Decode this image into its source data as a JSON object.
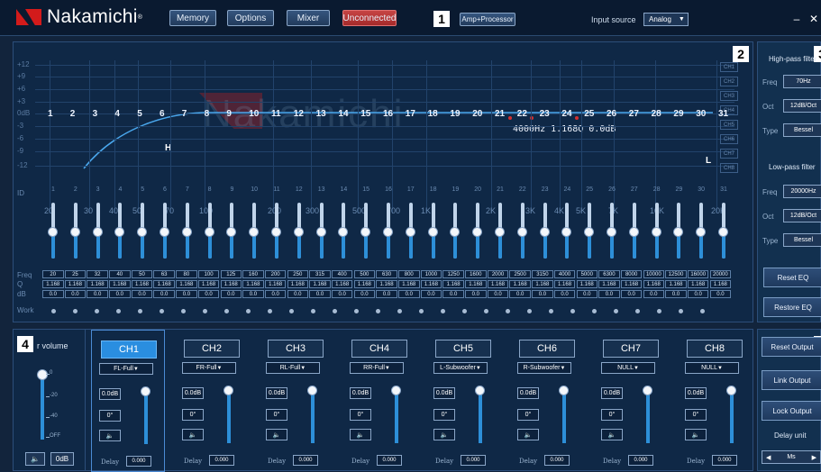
{
  "app": {
    "brand": "Nakamichi",
    "reg": "®"
  },
  "topbar": {
    "memory": "Memory",
    "options": "Options",
    "mixer": "Mixer",
    "connection": "Unconnected",
    "marker1": "1",
    "amp_processor": "Amp+Processor",
    "input_source_label": "Input source",
    "input_source_value": "Analog",
    "minimize": "–",
    "close": "✕"
  },
  "eq": {
    "marker": "2",
    "y_labels": [
      "+12",
      "+9",
      "+6",
      "+3",
      "0dB",
      "-3",
      "-6",
      "-9",
      "-12"
    ],
    "x_labels": [
      "20",
      "30",
      "40",
      "50",
      "70",
      "100",
      "200",
      "300",
      "500",
      "700",
      "1K",
      "2K",
      "3K",
      "4K",
      "5K",
      "7K",
      "10K",
      "20K"
    ],
    "ch_boxes": [
      "CH1",
      "CH2",
      "CH3",
      "CH4",
      "CH5",
      "CH6",
      "CH7",
      "CH8"
    ],
    "band_numbers": [
      "1",
      "2",
      "3",
      "4",
      "5",
      "6",
      "7",
      "8",
      "9",
      "10",
      "11",
      "12",
      "13",
      "14",
      "15",
      "16",
      "17",
      "18",
      "19",
      "20",
      "21",
      "22",
      "23",
      "24",
      "25",
      "26",
      "27",
      "28",
      "29",
      "30",
      "31"
    ],
    "readout": "4000Hz 1.168Q 0.0dB",
    "h_marker": "H",
    "l_marker": "L",
    "watermark": "Nakamichi",
    "id_label": "ID",
    "freq_label": "Freq",
    "q_label": "Q",
    "db_label": "dB",
    "work_label": "Work",
    "freqs": [
      "20",
      "25",
      "32",
      "40",
      "50",
      "63",
      "80",
      "100",
      "125",
      "160",
      "200",
      "250",
      "315",
      "400",
      "500",
      "630",
      "800",
      "1000",
      "1250",
      "1600",
      "2000",
      "2500",
      "3150",
      "4000",
      "5000",
      "6300",
      "8000",
      "10000",
      "12500",
      "16000",
      "20000"
    ],
    "q_value": "1.168",
    "db_value": "0.0"
  },
  "filter": {
    "marker": "3",
    "hp_title": "High-pass filter",
    "freq_label": "Freq",
    "oct_label": "Oct",
    "type_label": "Type",
    "hp_freq": "70Hz",
    "hp_oct": "12dB/Oct",
    "hp_type": "Bessel",
    "lp_title": "Low-pass filter",
    "lp_freq": "20000Hz",
    "lp_oct": "12dB/Oct",
    "lp_type": "Bessel",
    "reset_eq": "Reset EQ",
    "restore_eq": "Restore EQ"
  },
  "volume": {
    "marker": "4",
    "title": "r volume",
    "ticks": [
      "0",
      "-20",
      "-40",
      "OFF"
    ],
    "level_db": "0dB",
    "mute_icon": "speaker-icon",
    "level_fraction": 1.0
  },
  "channels": [
    {
      "name": "CH1",
      "output": "FL-Full",
      "gain": "0.0dB",
      "phase": "0°",
      "delay_label": "Delay",
      "delay": "0.000"
    },
    {
      "name": "CH2",
      "output": "FR-Full",
      "gain": "0.0dB",
      "phase": "0°",
      "delay_label": "Delay",
      "delay": "0.000"
    },
    {
      "name": "CH3",
      "output": "RL-Full",
      "gain": "0.0dB",
      "phase": "0°",
      "delay_label": "Delay",
      "delay": "0.000"
    },
    {
      "name": "CH4",
      "output": "RR-Full",
      "gain": "0.0dB",
      "phase": "0°",
      "delay_label": "Delay",
      "delay": "0.000"
    },
    {
      "name": "CH5",
      "output": "L-Subwoofer",
      "gain": "0.0dB",
      "phase": "0°",
      "delay_label": "Delay",
      "delay": "0.000"
    },
    {
      "name": "CH6",
      "output": "R-Subwoofer",
      "gain": "0.0dB",
      "phase": "0°",
      "delay_label": "Delay",
      "delay": "0.000"
    },
    {
      "name": "CH7",
      "output": "NULL",
      "gain": "0.0dB",
      "phase": "0°",
      "delay_label": "Delay",
      "delay": "0.000"
    },
    {
      "name": "CH8",
      "output": "NULL",
      "gain": "0.0dB",
      "phase": "0°",
      "delay_label": "Delay",
      "delay": "0.000"
    }
  ],
  "outputs": {
    "marker": "5",
    "reset_output": "Reset Output",
    "link_output": "Link Output",
    "lock_output": "Lock Output",
    "delay_unit_label": "Delay unit",
    "delay_unit_value": "Ms"
  },
  "colors": {
    "accent": "#2d8fd8",
    "brand_red": "#d31b1b",
    "danger": "#c64444",
    "background": "#12243c"
  }
}
